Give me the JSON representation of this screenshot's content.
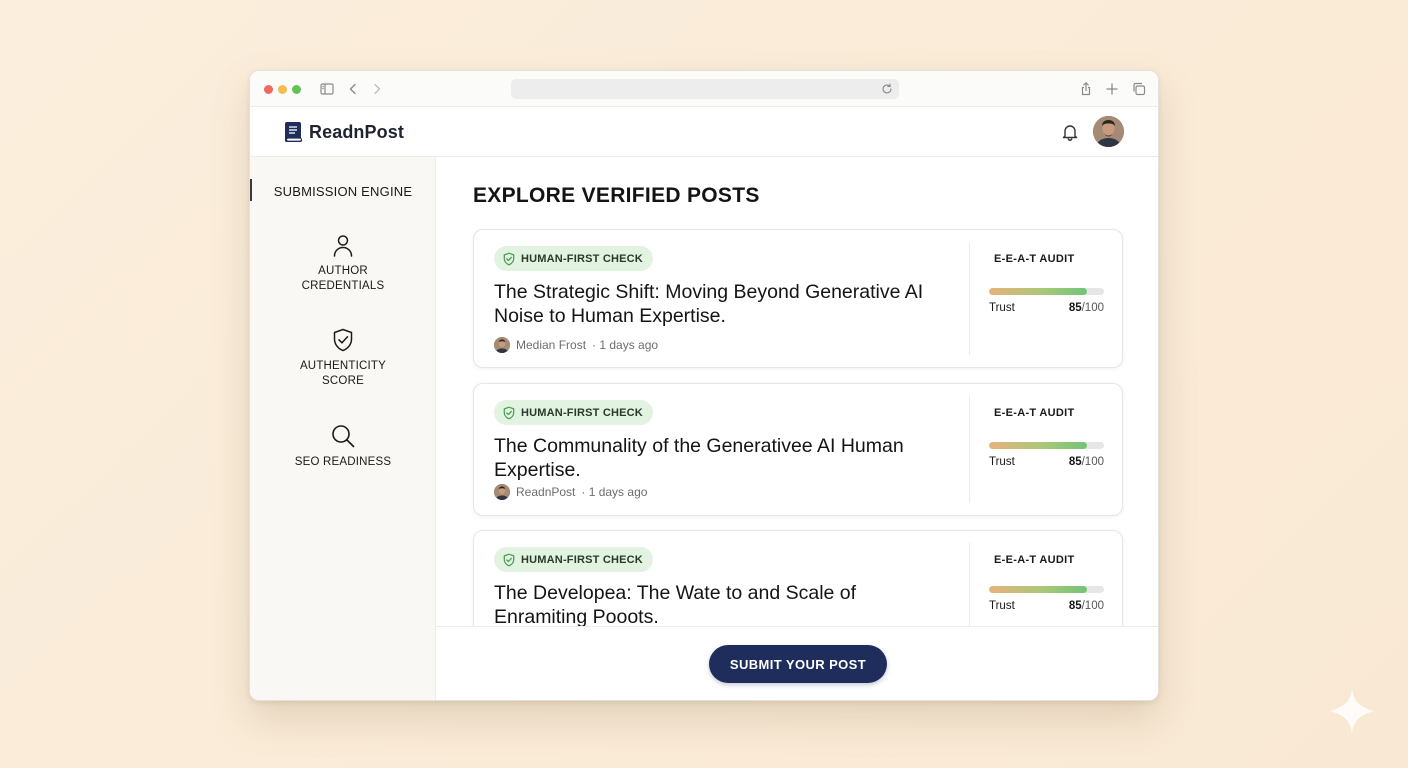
{
  "app": {
    "name": "ReadnPost",
    "brand_color": "#1e2d5c",
    "accent_color": "#72c47a"
  },
  "browser": {
    "url": "",
    "icons": [
      "sidebar-toggle-icon",
      "back-icon",
      "forward-icon",
      "reload-icon",
      "share-icon",
      "new-tab-icon",
      "tabs-overview-icon"
    ]
  },
  "header": {
    "icons": [
      "bell-icon",
      "avatar"
    ]
  },
  "sidebar": {
    "title": "SUBMISSION ENGINE",
    "items": [
      {
        "line1": "AUTHOR",
        "line2": "CREDENTIALS",
        "icon": "user-icon"
      },
      {
        "line1": "AUTHENTICITY",
        "line2": "SCORE",
        "icon": "shield-check-icon"
      },
      {
        "line1": "SEO READINESS",
        "line2": "",
        "icon": "search-icon"
      }
    ]
  },
  "main": {
    "title": "EXPLORE VERIFIED POSTS",
    "posts": [
      {
        "badge": "HUMAN-FIRST CHECK",
        "title": "The Strategic Shift: Moving Beyond Generative AI Noise to Human Expertise.",
        "author": "Median Frost",
        "time": "· 1 days ago",
        "audit_label": "E-E-A-T AUDIT",
        "trust_label": "Trust",
        "trust_score": "85",
        "trust_max": "/100",
        "trust_fraction": 0.85
      },
      {
        "badge": "HUMAN-FIRST CHECK",
        "title": "The Communality of the Generativee AI Human Expertise.",
        "author": "ReadnPost",
        "time": "· 1 days ago",
        "audit_label": "E-E-A-T AUDIT",
        "trust_label": "Trust",
        "trust_score": "85",
        "trust_max": "/100",
        "trust_fraction": 0.85
      },
      {
        "badge": "HUMAN-FIRST CHECK",
        "title": "The Developea: The Wate to and Scale of Enramiting Pooots.",
        "author": "",
        "time": "",
        "audit_label": "E-E-A-T AUDIT",
        "trust_label": "Trust",
        "trust_score": "85",
        "trust_max": "/100",
        "trust_fraction": 0.85
      }
    ]
  },
  "footer": {
    "submit_label": "SUBMIT YOUR POST"
  }
}
